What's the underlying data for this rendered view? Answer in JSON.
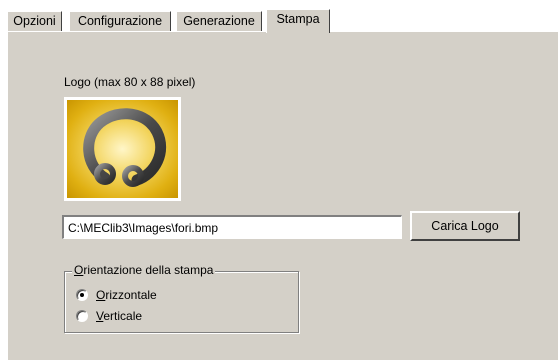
{
  "tabs": [
    {
      "label": "Opzioni",
      "active": false
    },
    {
      "label": "Configurazione",
      "active": false
    },
    {
      "label": "Generazione",
      "active": false
    },
    {
      "label": "Stampa",
      "active": true
    }
  ],
  "logo": {
    "caption": "Logo (max 80 x 88 pixel)",
    "icon": "ring-logo-icon"
  },
  "file_path": {
    "value": "C:\\MEClib3\\Images\\fori.bmp"
  },
  "load_button": {
    "label": "Carica Logo"
  },
  "orientation": {
    "title": "Orientazione della stampa",
    "options": [
      {
        "label": "Orizzontale",
        "checked": true
      },
      {
        "label": "Verticale",
        "checked": false
      }
    ]
  },
  "colors": {
    "face": "#d4d0c8",
    "logo_gold": "#e0b012"
  }
}
